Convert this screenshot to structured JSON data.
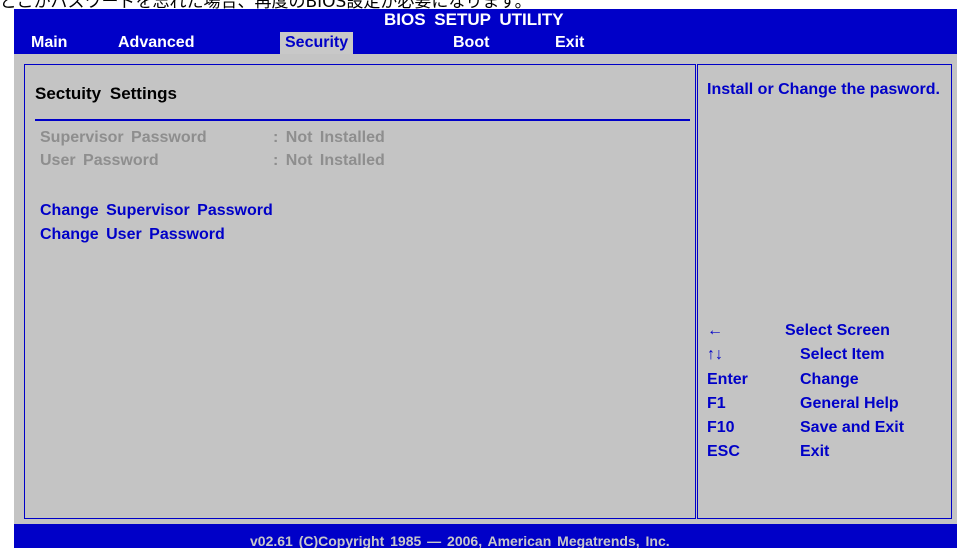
{
  "caption_above": "どこかパスワードを忘れた場合、再度のBIOS設定が必要になります。",
  "title": "BIOS  SETUP  UTILITY",
  "menu": [
    {
      "label": "Main"
    },
    {
      "label": "Advanced"
    },
    {
      "label": "Security",
      "active": true
    },
    {
      "label": "Boot"
    },
    {
      "label": "Exit"
    }
  ],
  "section": {
    "title": "Sectuity  Settings"
  },
  "status": [
    {
      "label": "Supervisor  Password",
      "value": ": Not  Installed"
    },
    {
      "label": "User  Password",
      "value": ": Not  Installed"
    }
  ],
  "actions": [
    {
      "label": "Change  Supervisor  Password"
    },
    {
      "label": "Change  User  Password"
    }
  ],
  "help": {
    "text": "Install or Change the pasword."
  },
  "keys": [
    {
      "key": "←",
      "desc": "Select Screen"
    },
    {
      "key": "↑↓",
      "desc": "Select  Item"
    },
    {
      "key": "Enter",
      "desc": "Change"
    },
    {
      "key": "F1",
      "desc": "General  Help"
    },
    {
      "key": "F10",
      "desc": "Save and Exit"
    },
    {
      "key": "ESC",
      "desc": "Exit"
    }
  ],
  "footer": "v02.61  (C)Copyright  1985 — 2006,   American  Megatrends,  Inc.",
  "colors": {
    "bios_blue": "#0000c8",
    "panel_gray": "#c4c4c4",
    "disabled_text": "#8e8e8e"
  }
}
